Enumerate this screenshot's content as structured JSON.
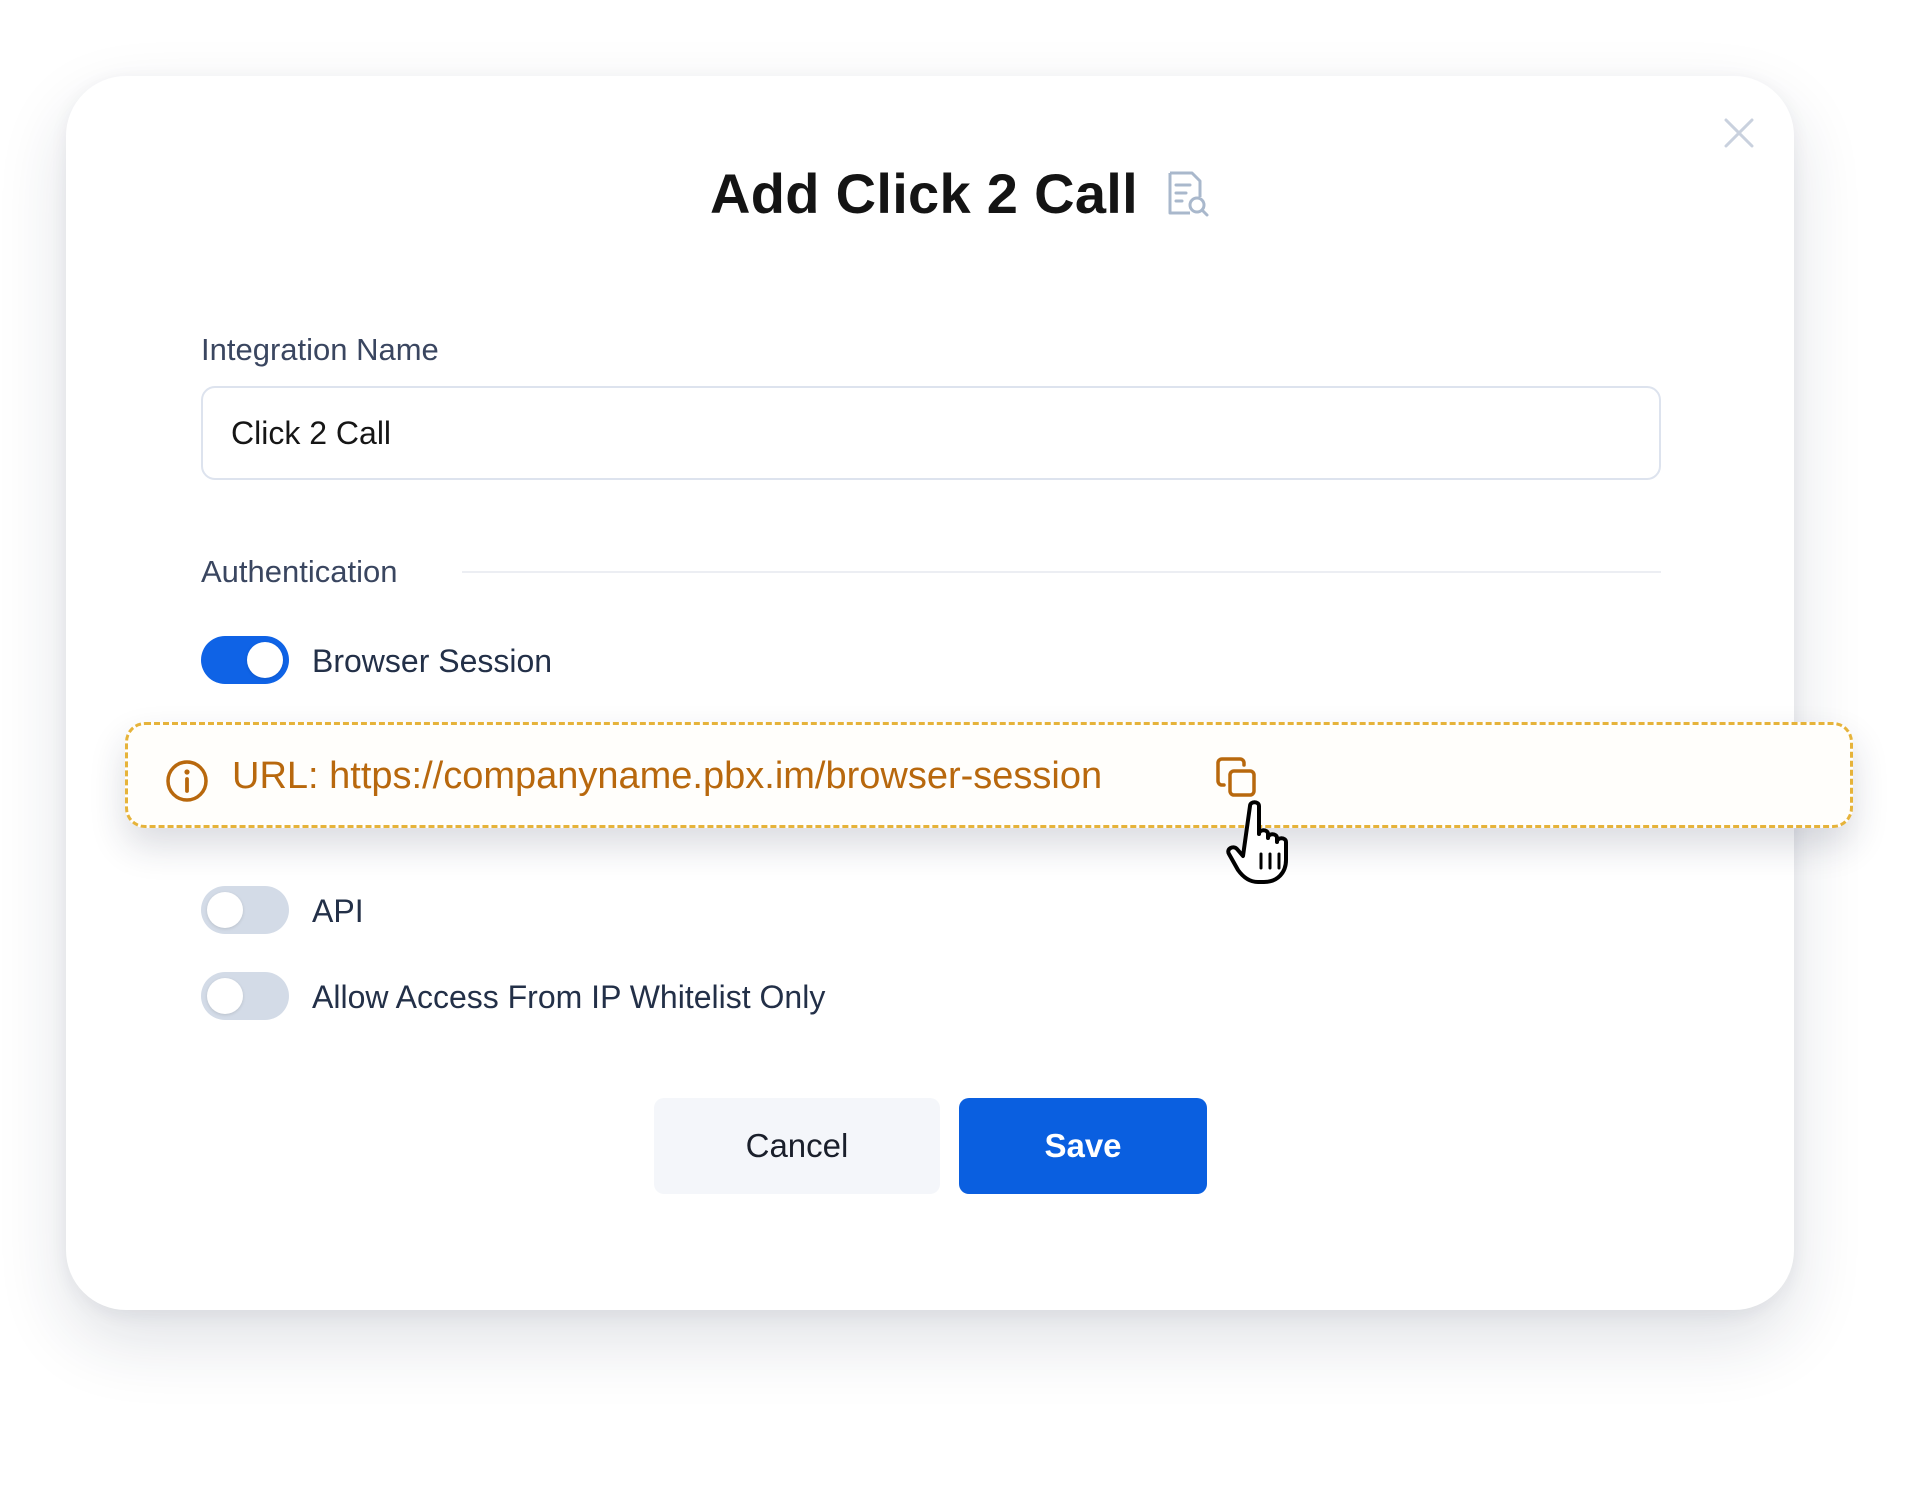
{
  "modal": {
    "title": "Add Click 2 Call",
    "title_icon": "document-search-icon",
    "close_icon": "close-icon"
  },
  "integration": {
    "label": "Integration Name",
    "value": "Click 2 Call"
  },
  "authentication": {
    "section_label": "Authentication",
    "options": [
      {
        "label": "Browser Session",
        "enabled": true
      },
      {
        "label": "API",
        "enabled": false
      },
      {
        "label": "Allow Access From IP Whitelist Only",
        "enabled": false
      }
    ]
  },
  "url_banner": {
    "text": "URL: https://companyname.pbx.im/browser-session",
    "info_icon": "info-icon",
    "copy_icon": "copy-icon",
    "cursor_icon": "hand-pointer-icon"
  },
  "actions": {
    "cancel_label": "Cancel",
    "save_label": "Save"
  },
  "colors": {
    "primary": "#0a5fe0",
    "toggle_on": "#0f63e6",
    "toggle_off": "#d3dbe7",
    "banner_accent": "#e6b33a",
    "banner_text": "#b8680d"
  }
}
